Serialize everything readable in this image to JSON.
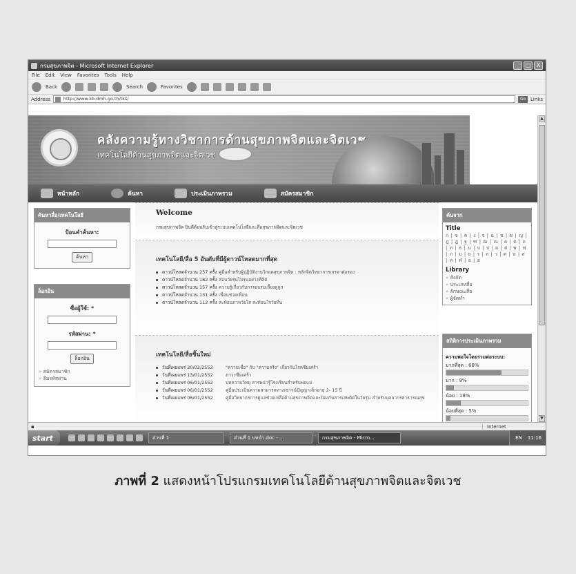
{
  "window": {
    "title": "กรมสุขภาพจิต - Microsoft Internet Explorer",
    "buttons": [
      "_",
      "□",
      "X"
    ]
  },
  "menu": [
    "File",
    "Edit",
    "View",
    "Favorites",
    "Tools",
    "Help"
  ],
  "toolbar": {
    "back": "Back",
    "search": "Search",
    "favorites": "Favorites"
  },
  "address": {
    "label": "Address",
    "url": "http://www.kb.dmh.go.th/tks/",
    "go": "Go",
    "links": "Links"
  },
  "banner": {
    "title": "คลังความรู้ทางวิชาการด้านสุขภาพจิตและจิตเวช",
    "subtitle": "เทคโนโลยีด้านสุขภาพจิตและจิตเวช"
  },
  "nav": [
    "หน้าหลัก",
    "ค้นหา",
    "ประเมินภาพรวม",
    "สมัครสมาชิก"
  ],
  "search_box": {
    "header": "ค้นหาสื่อ/เทคโนโลยี",
    "label": "ป้อนคำค้นหา:",
    "button": "ค้นหา"
  },
  "login_box": {
    "header": "ล็อกอิน",
    "user_label": "ชื่อผู้ใช้: *",
    "pass_label": "รหัสผ่าน: *",
    "button": "ล็อกอิน",
    "links": [
      "สมัครสมาชิก",
      "ลืมรหัสผ่าน"
    ]
  },
  "welcome": {
    "title": "Welcome",
    "text": "กรมสุขภาพจิต ยินดีต้อนรับเข้าสู่ระบบเทคโนโลยีและสื่อสุขภาพจิตและจิตเวช"
  },
  "top5": {
    "title": "เทคโนโลยี/สื่อ 5 อันดับที่มีผู้ดาวน์โหลดมากที่สุด",
    "items": [
      {
        "downloads": "ดาวน์โหลดจำนวน 257 ครั้ง",
        "title": "คู่มือสำหรับผู้ปฏิบัติงานวิกฤตสุขภาพจิต : หลักจิตวิทยาการเจรจาต่อรอง"
      },
      {
        "downloads": "ดาวน์โหลดจำนวน 182 ครั้ง",
        "title": "สอนวัยรุ่นไม่รุนอย่างที่คิด"
      },
      {
        "downloads": "ดาวน์โหลดจำนวน 157 ครั้ง",
        "title": "ความรู้เกี่ยวกับการอบรมเลี้ยงดูลูก"
      },
      {
        "downloads": "ดาวน์โหลดจำนวน 131 ครั้ง",
        "title": "เพื่อนช่วยเพื่อน"
      },
      {
        "downloads": "ดาวน์โหลดจำนวน 112 ครั้ง",
        "title": "สะท้อนภาพวัยใส สะท้อนใจวัยทีน"
      }
    ]
  },
  "newest": {
    "title": "เทคโนโลยี/สื่อชิ้นใหม่",
    "items": [
      {
        "date": "วันที่เผยแพร่ 20/02/2552",
        "title": "\"ความเชื่อ\" กับ \"ความจริง\" เกี่ยวกับโรคซึมเศร้า"
      },
      {
        "date": "วันที่เผยแพร่ 13/01/2552",
        "title": "ภาวะซึมเศร้า"
      },
      {
        "date": "วันที่เผยแพร่ 06/01/2552",
        "title": "บทความวิทยุ สารพน่ารู้โรงเรียนสำหรับพ่อแม่"
      },
      {
        "date": "วันที่เผยแพร่ 06/01/2552",
        "title": "คู่มือประเมินความสามารถทางเชาวน์ปัญญาเด็กอายุ 2- 15 ปี"
      },
      {
        "date": "วันที่เผยแพร่ 06/01/2552",
        "title": "คู่มือวิทยากรการดูแลช่วยเหลือด้านสุขภาพจิตและป้องกันสารเสพติดในวัยรุ่น สำหรับบุคลากรสาธารณสุข"
      }
    ]
  },
  "browse": {
    "header": "ค้นจาก",
    "title_label": "Title",
    "alphabet": "ก | ข | ค | ง | จ | ฉ | ช | ซ | ญ | ฎ | ฏ | ฐ | ฑ | ฒ | ณ | ด | ต | ถ | ท | ธ | น | บ | ป | ผ | ฝ | พ | ฟ | ภ | ม | ย | ร | ล | ว | ศ | ษ | ส | ห | ฬ | อ | ฮ",
    "library_label": "Library",
    "library": [
      "สังกัด",
      "ประเภทสื่อ",
      "ลักษณะสื่อ",
      "ผู้จัดทำ"
    ]
  },
  "stats": {
    "header": "สถิติการประเมินภาพรวม",
    "question": "ความพอใจโดยรวมต่อระบบ:",
    "rows": [
      {
        "label": "มากที่สุด : 68%",
        "pct": 68
      },
      {
        "label": "มาก : 9%",
        "pct": 9
      },
      {
        "label": "น้อย : 18%",
        "pct": 18
      },
      {
        "label": "น้อยที่สุด : 5%",
        "pct": 5
      }
    ]
  },
  "status": {
    "zone": "Internet"
  },
  "taskbar": {
    "start": "start",
    "tasks": [
      "ส่วนที่ 1",
      "ส่วนที่ 1 บทนำ.doc - ...",
      "กรมสุขภาพจิต - Micro..."
    ],
    "lang": "EN",
    "time": "11:16"
  },
  "caption": {
    "bold": "ภาพที่ 2",
    "text": "แสดงหน้าโปรแกรมเทคโนโลยีด้านสุขภาพจิตและจิตเวช"
  }
}
